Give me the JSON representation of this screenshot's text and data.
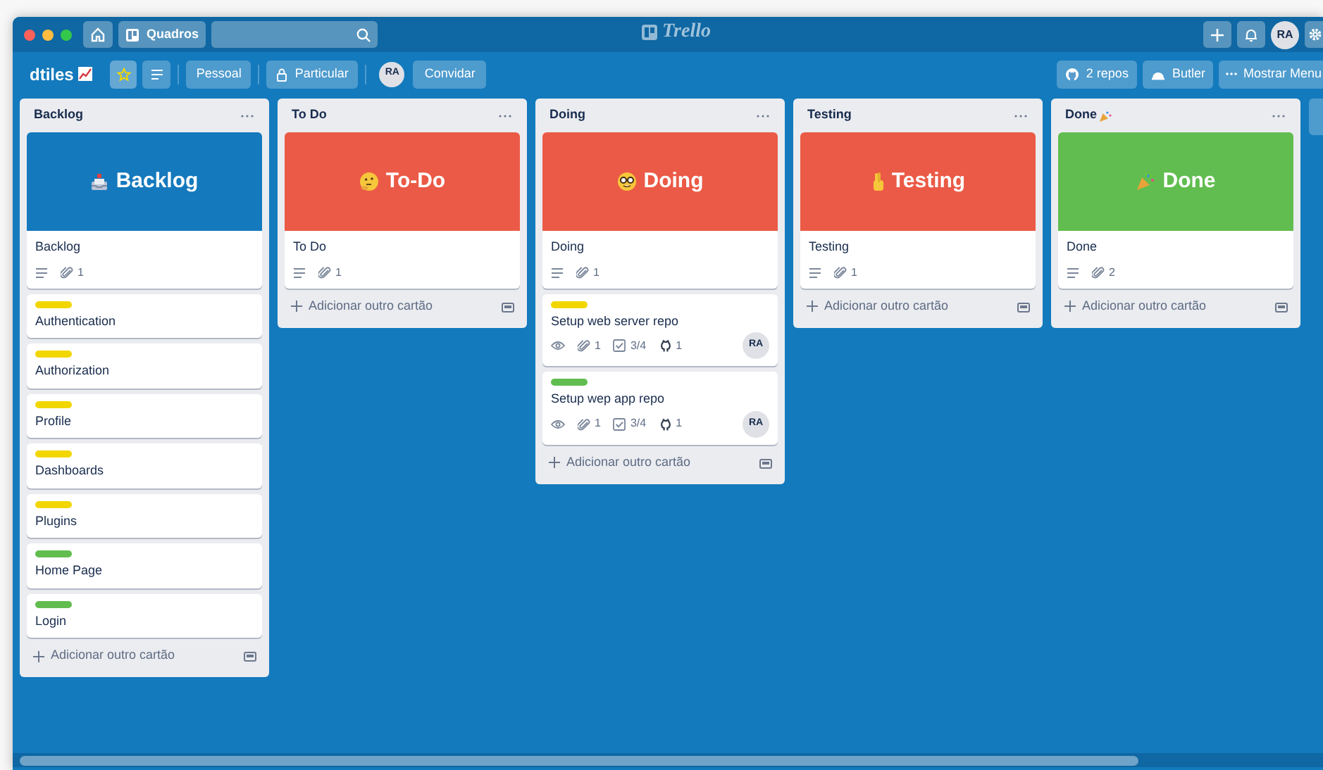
{
  "top_bar": {
    "boards_button": "Quadros",
    "logo": "Trello",
    "avatar": "RA"
  },
  "board_header": {
    "name": "dtiles",
    "starred": true,
    "team_button": "Pessoal",
    "visibility_button": "Particular",
    "member_avatar": "RA",
    "invite_button": "Convidar",
    "github_button": "2 repos",
    "butler_button": "Butler",
    "menu_button": "Mostrar Menu"
  },
  "lists": [
    {
      "title": "Backlog",
      "title_emoji": false,
      "add_card": "Adicionar outro cartão",
      "cards": [
        {
          "kind": "cover",
          "color": "#1479bd",
          "cover_title": "Backlog",
          "title": "Backlog",
          "badges": [
            {
              "kind": "description"
            },
            {
              "kind": "attachment",
              "text": "1"
            }
          ]
        },
        {
          "kind": "label",
          "color": "#f2d600",
          "title": "Authentication"
        },
        {
          "kind": "label",
          "color": "#f2d600",
          "title": "Authorization"
        },
        {
          "kind": "label",
          "color": "#f2d600",
          "title": "Profile"
        },
        {
          "kind": "label",
          "color": "#f2d600",
          "title": "Dashboards"
        },
        {
          "kind": "label",
          "color": "#f2d600",
          "title": "Plugins"
        },
        {
          "kind": "label",
          "color": "#61bd4f",
          "title": "Home Page"
        },
        {
          "kind": "label",
          "color": "#61bd4f",
          "title": "Login"
        }
      ]
    },
    {
      "title": "To Do",
      "title_emoji": false,
      "add_card": "Adicionar outro cartão",
      "cards": [
        {
          "kind": "cover",
          "color": "#eb5a46",
          "cover_title": "To-Do",
          "title": "To Do",
          "badges": [
            {
              "kind": "description"
            },
            {
              "kind": "attachment",
              "text": "1"
            }
          ]
        }
      ]
    },
    {
      "title": "Doing",
      "title_emoji": false,
      "add_card": "Adicionar outro cartão",
      "cards": [
        {
          "kind": "cover",
          "color": "#eb5a46",
          "cover_title": "Doing",
          "title": "Doing",
          "badges": [
            {
              "kind": "description"
            },
            {
              "kind": "attachment",
              "text": "1"
            }
          ]
        },
        {
          "kind": "label",
          "color": "#f2d600",
          "title": "Setup web server repo",
          "member": "RA",
          "badges": [
            {
              "kind": "watch"
            },
            {
              "kind": "attachment",
              "text": "1"
            },
            {
              "kind": "checklist",
              "text": "3/4"
            },
            {
              "kind": "github",
              "text": "1"
            }
          ]
        },
        {
          "kind": "label",
          "color": "#61bd4f",
          "title": "Setup wep app repo",
          "member": "RA",
          "badges": [
            {
              "kind": "watch"
            },
            {
              "kind": "attachment",
              "text": "1"
            },
            {
              "kind": "checklist",
              "text": "3/4"
            },
            {
              "kind": "github",
              "text": "1"
            }
          ]
        }
      ]
    },
    {
      "title": "Testing",
      "title_emoji": false,
      "add_card": "Adicionar outro cartão",
      "cards": [
        {
          "kind": "cover",
          "color": "#eb5a46",
          "cover_title": "Testing",
          "title": "Testing",
          "badges": [
            {
              "kind": "description"
            },
            {
              "kind": "attachment",
              "text": "1"
            }
          ]
        }
      ]
    },
    {
      "title": "Done",
      "title_emoji": true,
      "add_card": "Adicionar outro cartão",
      "cards": [
        {
          "kind": "cover",
          "color": "#61bd4f",
          "cover_title": "Done",
          "title": "Done",
          "badges": [
            {
              "kind": "description"
            },
            {
              "kind": "attachment",
              "text": "2"
            }
          ]
        }
      ]
    }
  ]
}
